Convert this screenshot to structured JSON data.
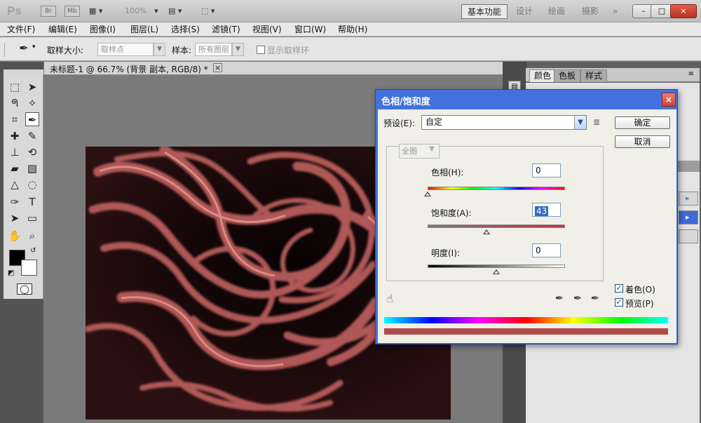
{
  "app": {
    "logo": "Ps",
    "bridge_label": "Br",
    "minibridge_label": "Mb",
    "zoom": "100%",
    "workspaces": [
      "基本功能",
      "设计",
      "绘画",
      "摄影",
      "»"
    ],
    "window_buttons": [
      "–",
      "□",
      "×"
    ]
  },
  "menubar": [
    "文件(F)",
    "编辑(E)",
    "图像(I)",
    "图层(L)",
    "选择(S)",
    "滤镜(T)",
    "视图(V)",
    "窗口(W)",
    "帮助(H)"
  ],
  "options": {
    "sample_size_label": "取样大小:",
    "sample_size_value": "取样点",
    "sample_label": "样本:",
    "sample_value": "所有图层",
    "show_ring_label": "显示取样环"
  },
  "document": {
    "tab_title": "未标题-1 @ 66.7% (背景 副本, RGB/8) *",
    "close_symbol": "×"
  },
  "panel": {
    "tabs": [
      "颜色",
      "色板",
      "样式"
    ]
  },
  "dialog": {
    "title": "色相/饱和度",
    "close": "×",
    "preset_label": "预设(E):",
    "preset_value": "自定",
    "ok": "确定",
    "cancel": "取消",
    "channel": "全图",
    "hue_label": "色相(H):",
    "hue_value": "0",
    "saturation_label": "饱和度(A):",
    "saturation_value": "43",
    "lightness_label": "明度(I):",
    "lightness_value": "0",
    "colorize_label": "着色(O)",
    "preview_label": "预览(P)",
    "colorize_checked": true,
    "preview_checked": true,
    "hue_slider_fraction": 0.0,
    "saturation_slider_fraction": 0.43,
    "lightness_slider_fraction": 0.5,
    "result_color": "#b24a49"
  }
}
